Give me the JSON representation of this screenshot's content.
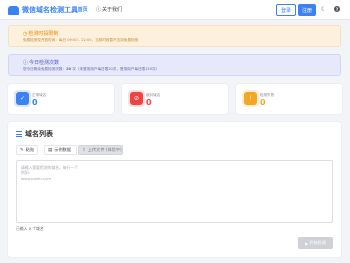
{
  "header": {
    "app_title": "微信域名检测工具",
    "nav": [
      {
        "label": "首页",
        "icon": "home-icon"
      },
      {
        "label": "关于我们",
        "icon": "info-icon"
      }
    ],
    "login_label": "登录",
    "register_label": "注册",
    "theme_icon": "moon-icon",
    "help_icon": "help-icon"
  },
  "alerts": {
    "warning": {
      "title": "检测时段限制",
      "text": "免费检测仅开放时间：每日 09:00 - 22:00，当前时段暂不支持免费检测"
    },
    "info": {
      "title": "今日检测次数",
      "text_prefix": "您今日剩余免费检测次数：",
      "count": "20",
      "text_suffix": " 次（未登录用户每日限20次，登录用户每日限150次）"
    }
  },
  "stats": [
    {
      "label": "正常域名",
      "value": "0",
      "icon": "check-icon",
      "color": "#3b82f6"
    },
    {
      "label": "被封域名",
      "value": "0",
      "icon": "blocked-icon",
      "color": "#ef4444"
    },
    {
      "label": "检测失败",
      "value": "0",
      "icon": "warning-icon",
      "color": "#f5a623"
    }
  ],
  "domain_list": {
    "title": "域名列表",
    "tabs": [
      {
        "label": "粘贴",
        "icon": "paste-icon"
      },
      {
        "label": "示例数据",
        "icon": "document-icon"
      },
      {
        "label": "上传文件 (体验中)",
        "icon": "upload-icon"
      }
    ],
    "placeholder_lines": [
      "请输入需要检测的域名，每行一个",
      "例如:",
      "www.baidu.com"
    ],
    "count_text": "已输入 0 个域名",
    "start_label": "开始检测"
  },
  "colors": {
    "accent": "#3b82f6",
    "danger": "#ef4444",
    "warning": "#f5a623"
  }
}
